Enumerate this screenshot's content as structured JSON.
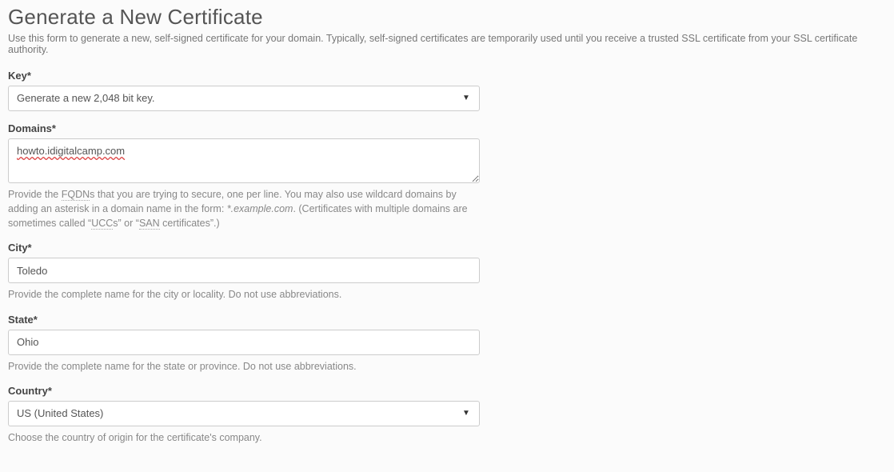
{
  "heading": "Generate a New Certificate",
  "intro": "Use this form to generate a new, self-signed certificate for your domain. Typically, self-signed certificates are temporarily used until you receive a trusted SSL certificate from your SSL certificate authority.",
  "fields": {
    "key": {
      "label": "Key*",
      "selected": "Generate a new 2,048 bit key."
    },
    "domains": {
      "label": "Domains*",
      "value": "howto.idigitalcamp.com",
      "help_pre": "Provide the ",
      "help_fqdn": "FQDN",
      "help_mid1": "s that you are trying to secure, one per line. You may also use wildcard domains by adding an asterisk in a domain name in the form: ",
      "help_example": "*.example.com",
      "help_mid2": ". (Certificates with multiple domains are sometimes called “",
      "help_ucc": "UCC",
      "help_mid3": "s” or “",
      "help_san": "SAN",
      "help_post": " certificates”.)"
    },
    "city": {
      "label": "City*",
      "value": "Toledo",
      "help": "Provide the complete name for the city or locality. Do not use abbreviations."
    },
    "state": {
      "label": "State*",
      "value": "Ohio",
      "help": "Provide the complete name for the state or province. Do not use abbreviations."
    },
    "country": {
      "label": "Country*",
      "selected": "US (United States)",
      "help": "Choose the country of origin for the certificate's company."
    }
  }
}
